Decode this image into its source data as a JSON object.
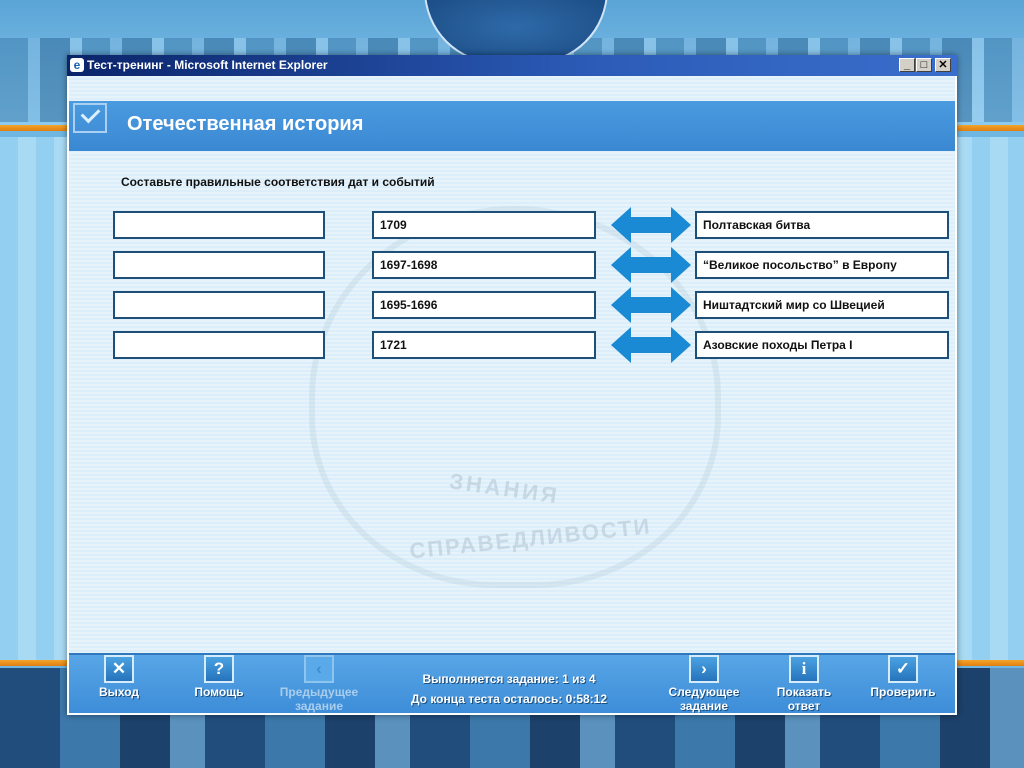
{
  "window": {
    "title": "Тест-тренинг - Microsoft Internet Explorer",
    "minimize_glyph": "_",
    "maximize_glyph": "□",
    "close_glyph": "✕"
  },
  "header": {
    "title": "Отечественная история"
  },
  "task": {
    "instruction": "Составьте правильные соответствия дат и событий",
    "answer_slots": [
      "",
      "",
      "",
      ""
    ],
    "dates": [
      "1709",
      "1697-1698",
      "1695-1696",
      "1721"
    ],
    "events": [
      "Полтавская битва",
      "“Великое посольство” в Европу",
      "Ништадтский мир со Швецией",
      "Азовские походы Петра I"
    ]
  },
  "watermark": {
    "line1": "ЗНАНИЯ",
    "line2": "СПРАВЕДЛИВОСТИ"
  },
  "toolbar": {
    "exit": {
      "label": "Выход",
      "icon": "close-x-icon",
      "glyph": "✕"
    },
    "help": {
      "label": "Помощь",
      "icon": "question-icon",
      "glyph": "?"
    },
    "prev": {
      "label": "Предыдущее задание",
      "icon": "chevron-left-icon",
      "glyph": "‹"
    },
    "next": {
      "label": "Следующее задание",
      "icon": "chevron-right-icon",
      "glyph": "›"
    },
    "show": {
      "label": "Показать ответ",
      "icon": "info-icon",
      "glyph": "i"
    },
    "check": {
      "label": "Проверить",
      "icon": "checkmark-icon",
      "glyph": "✓"
    },
    "status_task": "Выполняется задание: 1 из 4",
    "status_time": "До конца теста осталось: 0:58:12"
  },
  "colors": {
    "header": "#3f8fd6",
    "box_border": "#1d4f78",
    "arrow": "#1a8ad4",
    "accent_stripe": "#e88a18"
  }
}
